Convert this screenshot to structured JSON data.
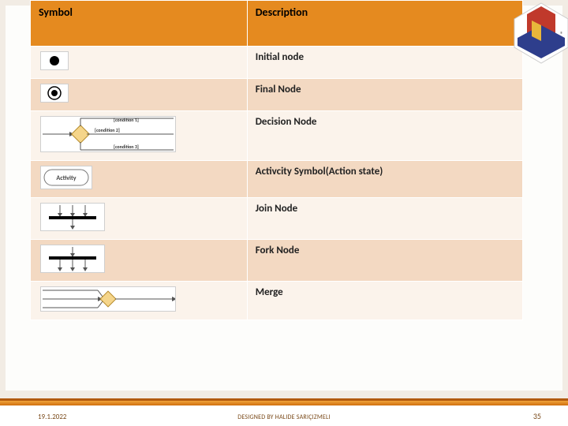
{
  "header": {
    "col1": "Symbol",
    "col2": "Description"
  },
  "rows": [
    {
      "desc": "Initial node"
    },
    {
      "desc": "Final Node"
    },
    {
      "desc": "Decision Node"
    },
    {
      "desc": "Activcity Symbol(Action state)"
    },
    {
      "desc": "Join Node"
    },
    {
      "desc": "Fork Node"
    },
    {
      "desc": "Merge"
    }
  ],
  "diagram_labels": {
    "cond1": "[condition 1]",
    "cond2": "[condition 2]",
    "cond3": "[condition 3]",
    "activity": "Activity"
  },
  "footer": {
    "date": "19.1.2022",
    "credit": "DESIGNED BY HALIDE SARIÇIZMELI",
    "page": "35"
  }
}
